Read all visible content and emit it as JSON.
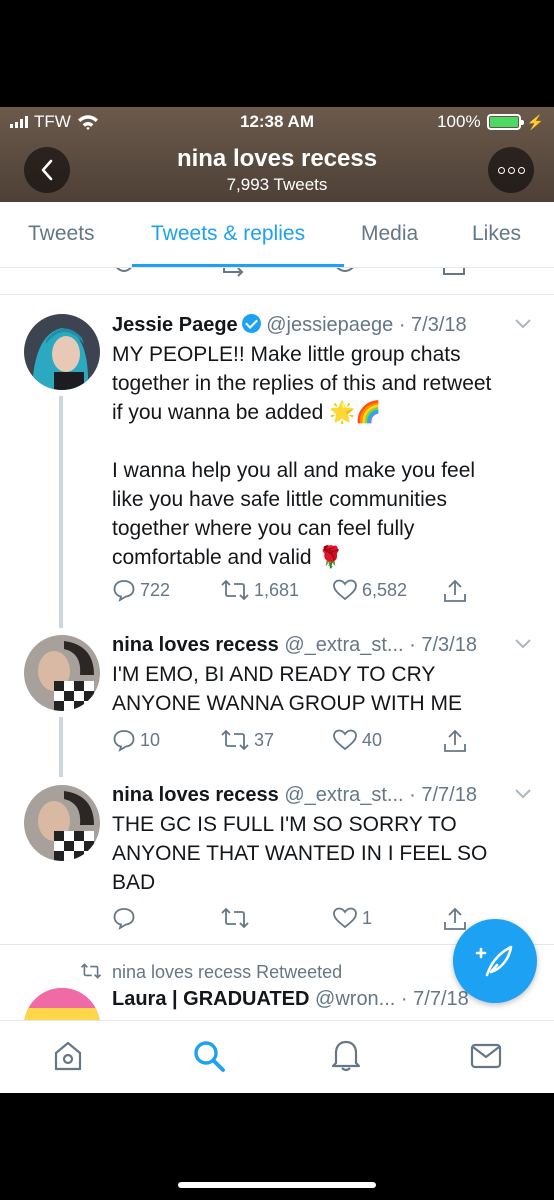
{
  "status_bar": {
    "carrier": "TFW",
    "time": "12:38 AM",
    "battery": "100%",
    "battery_level": 1.0
  },
  "header": {
    "title": "nina loves recess",
    "subtitle": "7,993 Tweets",
    "back_icon": "chevron-left-icon",
    "more_icon": "more-icon"
  },
  "tabs": [
    {
      "label": "Tweets",
      "active": false
    },
    {
      "label": "Tweets & replies",
      "active": true
    },
    {
      "label": "Media",
      "active": false
    },
    {
      "label": "Likes",
      "active": false
    }
  ],
  "tweets": [
    {
      "name": "Jessie Paege",
      "verified": true,
      "handle": "@jessiepaege",
      "date": "· 7/3/18",
      "lines": [
        "MY PEOPLE!! Make little group chats",
        "together in the replies of this and retweet",
        "if you wanna be added 🌟🌈",
        "",
        "I wanna help you all and make you feel",
        "like you have safe little communities",
        "together where you can feel fully",
        "comfortable and valid 🌹"
      ],
      "replies": "722",
      "retweets": "1,681",
      "likes": "6,582"
    },
    {
      "name": "nina loves recess",
      "verified": false,
      "handle": "@_extra_st...",
      "date": "· 7/3/18",
      "lines": [
        "I'M EMO, BI AND READY TO CRY",
        "ANYONE WANNA GROUP WITH ME"
      ],
      "replies": "10",
      "retweets": "37",
      "likes": "40"
    },
    {
      "name": "nina loves recess",
      "verified": false,
      "handle": "@_extra_st...",
      "date": "· 7/7/18",
      "lines": [
        "THE GC IS FULL I'M SO SORRY TO",
        "ANYONE THAT WANTED IN I FEEL SO",
        "BAD"
      ],
      "replies": "",
      "retweets": "",
      "likes": "1"
    }
  ],
  "retweet_row": {
    "label": "nina loves recess Retweeted",
    "name": "Laura | GRADUATED",
    "handle": "@wron...",
    "date": "· 7/7/18"
  },
  "bottom_nav": [
    "home-icon",
    "search-icon",
    "notifications-icon",
    "messages-icon"
  ],
  "colors": {
    "accent": "#1da1f2",
    "muted": "#657786",
    "header_bg": "#5b4b40"
  }
}
